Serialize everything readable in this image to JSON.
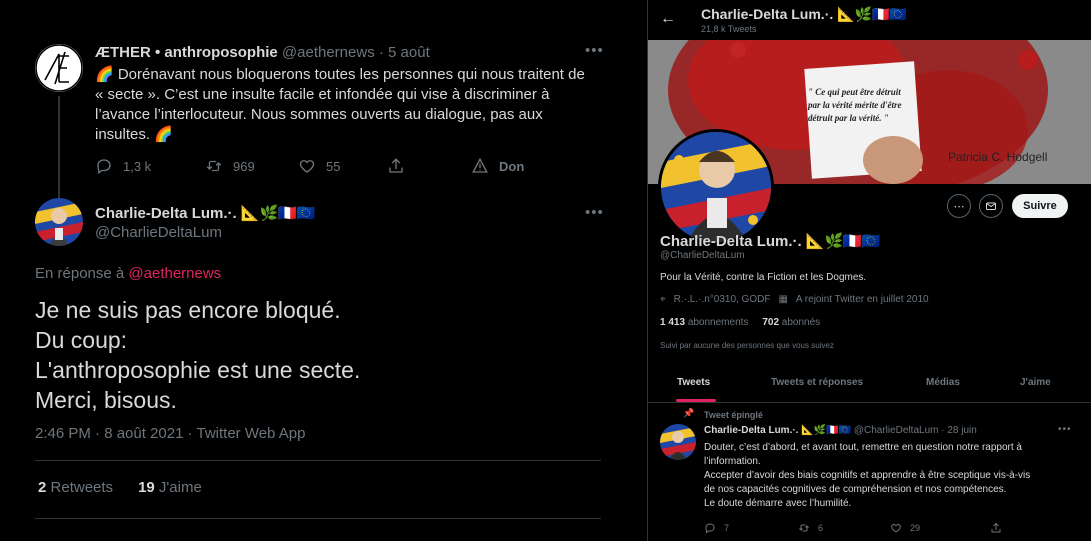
{
  "parent_tweet": {
    "display_name": "ÆTHER • anthroposophie",
    "handle": "@aethernews",
    "date": "· 5 août",
    "text_lines": [
      "🌈 Dorénavant nous bloquerons toutes les personnes qui nous traitent de",
      "« secte ». C’est une insulte facile et infondée qui vise à discriminer à",
      "l’avance l’interlocuteur. Nous sommes ouverts au dialogue, pas aux",
      "insultes. 🌈"
    ],
    "replies": "1,3 k",
    "retweets": "969",
    "likes": "55",
    "donate": "Don"
  },
  "main_tweet": {
    "display_name": "Charlie-Delta Lum.·. 📐🌿🇫🇷🇪🇺",
    "handle": "@CharlieDeltaLum",
    "reply_prefix": "En réponse à",
    "reply_to": "@aethernews",
    "text_lines": [
      "Je ne suis pas encore bloqué.",
      "Du coup:",
      "L'anthroposophie est une secte.",
      "Merci, bisous."
    ],
    "timestamp": "2:46 PM · 8 août 2021 · Twitter Web App",
    "retweets_count": "2",
    "retweets_label": "Retweets",
    "likes_count": "19",
    "likes_label": "J'aime"
  },
  "profile": {
    "back_icon": "arrow-left-icon",
    "title": "Charlie-Delta Lum.·. 📐🌿🇫🇷🇪🇺",
    "tweet_count": "21,8 k Tweets",
    "banner_quote_lines": [
      "\" Ce qui peut être détruit",
      "par la vérité mérite d'être",
      "détruit par la vérité. \""
    ],
    "banner_author": "Patricia C. Hodgell",
    "follow_label": "Suivre",
    "name": "Charlie-Delta Lum.·. 📐🌿🇫🇷🇪🇺",
    "handle": "@CharlieDeltaLum",
    "bio": "Pour la Vérité, contre la Fiction et les Dogmes.",
    "location": "R.·.L.·.n°0310, GODF",
    "joined": "A rejoint Twitter en juillet 2010",
    "following_count": "1 413",
    "following_label": "abonnements",
    "followers_count": "702",
    "followers_label": "abonnés",
    "followed_by": "Suivi par aucune des personnes que vous suivez",
    "tabs": [
      "Tweets",
      "Tweets et réponses",
      "Médias",
      "J'aime"
    ]
  },
  "pinned_tweet": {
    "pinned_label": "Tweet épinglé",
    "display_name": "Charlie-Delta Lum.·. 📐🌿🇫🇷🇪🇺",
    "handle_date": "@CharlieDeltaLum · 28 juin",
    "text_lines": [
      "Douter, c’est d’abord, et avant tout, remettre en question notre rapport à",
      "l’information.",
      "Accepter d’avoir des biais cognitifs et apprendre à être sceptique vis-à-vis",
      "de nos capacités cognitives de compréhension et nos compétences.",
      "Le doute démarre avec l’humilité."
    ],
    "replies": "7",
    "retweets": "6",
    "likes": "29"
  },
  "colors": {
    "background": "#000000",
    "text": "#d9d9d9",
    "muted": "#6e767d",
    "link": "#e0245e",
    "divider": "#2f3336"
  }
}
